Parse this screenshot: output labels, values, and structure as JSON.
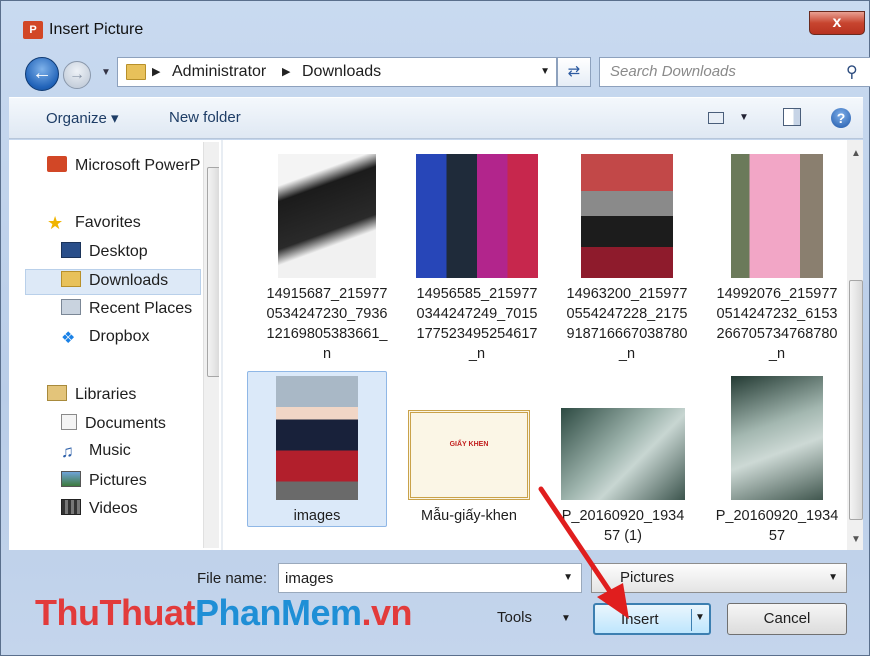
{
  "window": {
    "title": "Insert Picture",
    "app_icon": "P",
    "close_label": "x"
  },
  "nav": {
    "breadcrumb": [
      "Administrator",
      "Downloads"
    ],
    "search_placeholder": "Search Downloads"
  },
  "toolbar": {
    "organize": "Organize",
    "new_folder": "New folder"
  },
  "sidebar": {
    "items": [
      {
        "label": "Microsoft PowerP",
        "icon": "powerpoint-icon"
      },
      {
        "label": "Favorites",
        "icon": "star-icon"
      },
      {
        "label": "Desktop",
        "icon": "desktop-icon"
      },
      {
        "label": "Downloads",
        "icon": "downloads-icon",
        "selected": true
      },
      {
        "label": "Recent Places",
        "icon": "recent-places-icon"
      },
      {
        "label": "Dropbox",
        "icon": "dropbox-icon"
      },
      {
        "label": "Libraries",
        "icon": "libraries-icon"
      },
      {
        "label": "Documents",
        "icon": "documents-icon"
      },
      {
        "label": "Music",
        "icon": "music-icon"
      },
      {
        "label": "Pictures",
        "icon": "pictures-icon"
      },
      {
        "label": "Videos",
        "icon": "videos-icon"
      }
    ]
  },
  "files": [
    {
      "lines": [
        "14915687_215977",
        "0534247230_7936",
        "12169805383661_",
        "n"
      ]
    },
    {
      "lines": [
        "14956585_215977",
        "0344247249_7015",
        "177523495254617",
        "_n"
      ]
    },
    {
      "lines": [
        "14963200_215977",
        "0554247228_2175",
        "918716667038780",
        "_n"
      ]
    },
    {
      "lines": [
        "14992076_215977",
        "0514247232_6153",
        "266705734768780",
        "_n"
      ]
    },
    {
      "lines": [
        "images"
      ],
      "selected": true
    },
    {
      "lines": [
        "Mẫu-giấy-khen"
      ]
    },
    {
      "lines": [
        "P_20160920_1934",
        "57 (1)"
      ]
    },
    {
      "lines": [
        "P_20160920_1934",
        "57"
      ]
    }
  ],
  "certificate_heading": "GIẤY KHEN",
  "footer": {
    "file_name_label": "File name:",
    "file_name_value": "images",
    "file_type": "Pictures",
    "tools": "Tools",
    "insert": "Insert",
    "cancel": "Cancel"
  },
  "watermark": {
    "part1": "ThuThuat",
    "part2": "PhanMem",
    "part3": ".vn"
  },
  "colors": {
    "accent": "#3c7fb1",
    "selection": "#dbe9f9",
    "annotation_arrow": "#e01e1e"
  }
}
